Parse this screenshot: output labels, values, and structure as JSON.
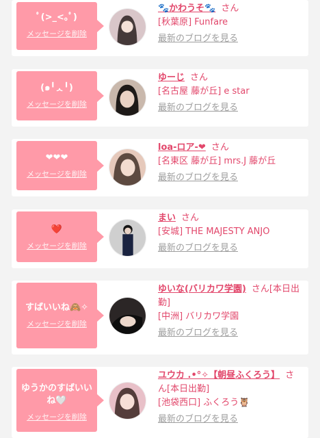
{
  "members": [
    {
      "message": "ﾟ(>_<｡ﾟ)",
      "delete": "メッセージを削除",
      "name": "🐾かわうそ🐾",
      "san": "さん",
      "shop": "[秋葉原] Funfare",
      "blog": "最新のブログを見る",
      "avatar_color": "#d9c6c9",
      "hair": "#2a2020"
    },
    {
      "message": "(๑╹ᆺ╹)",
      "delete": "メッセージを削除",
      "name": "ゆーじ",
      "san": "さん",
      "shop": "[名古屋 藤が丘] e star",
      "blog": "最新のブログを見る",
      "avatar_color": "#c9b8ac",
      "hair": "#1e1a18"
    },
    {
      "message": "❤❤❤",
      "delete": "メッセージを削除",
      "name": "loa-ロア-❤",
      "san": "さん",
      "shop": "[名東区 藤が丘] mrs.J 藤が丘",
      "blog": "最新のブログを見る",
      "avatar_color": "#e6c9bb",
      "hair": "#3b2a22"
    },
    {
      "message": "❤️",
      "delete": "メッセージを削除",
      "name": "まい",
      "san": "さん",
      "shop": "[安城] THE MAJESTY ANJO",
      "blog": "最新のブログを見る",
      "avatar_color": "#cfcfcf",
      "hair": "#151515"
    },
    {
      "message": "すばいいね🙈✧",
      "delete": "メッセージを削除",
      "name": "ゆいな(バリカワ学園)",
      "san": "さん[本日出勤]",
      "shop": "[中洲] バリカワ学園",
      "blog": "最新のブログを見る",
      "avatar_color": "#2b2626",
      "hair": "#0e0e0e"
    },
    {
      "message": "ゆうかのすばいいね🤍",
      "delete": "メッセージを削除",
      "name": "ユウカ .•°✧【朝昼ふくろう】",
      "san": "さん[本日出勤]",
      "shop": "[池袋西口] ふくろう🦉",
      "blog": "最新のブログを見る",
      "avatar_color": "#e8c0c8",
      "hair": "#3a2622"
    }
  ]
}
